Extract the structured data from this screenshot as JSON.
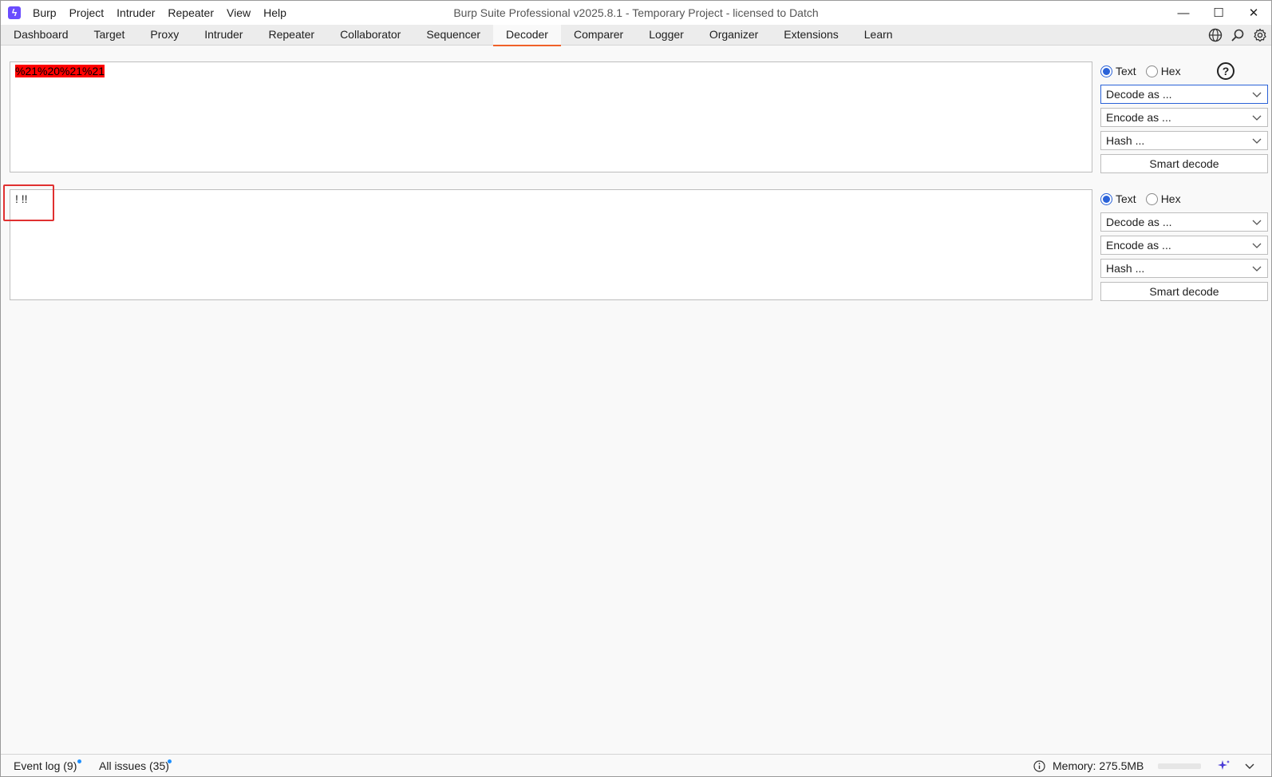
{
  "app": {
    "title": "Burp Suite Professional v2025.8.1 - Temporary Project - licensed to Datch",
    "logo_icon": "burp-logo-icon",
    "brand_color": "#6a4cff",
    "accent_color": "#f06129"
  },
  "menu": [
    "Burp",
    "Project",
    "Intruder",
    "Repeater",
    "View",
    "Help"
  ],
  "window_controls": {
    "minimize": "—",
    "maximize": "☐",
    "close": "✕"
  },
  "tabs": [
    {
      "label": "Dashboard"
    },
    {
      "label": "Target"
    },
    {
      "label": "Proxy"
    },
    {
      "label": "Intruder"
    },
    {
      "label": "Repeater"
    },
    {
      "label": "Collaborator"
    },
    {
      "label": "Sequencer"
    },
    {
      "label": "Decoder",
      "active": true
    },
    {
      "label": "Comparer"
    },
    {
      "label": "Logger"
    },
    {
      "label": "Organizer"
    },
    {
      "label": "Extensions"
    },
    {
      "label": "Learn"
    }
  ],
  "tab_icons": [
    "globe-icon",
    "search-icon",
    "gear-icon"
  ],
  "decoder": {
    "editor1": {
      "text": "%21%20%21%21"
    },
    "editor2": {
      "text": "! !!"
    },
    "panel": {
      "text_label": "Text",
      "hex_label": "Hex",
      "decode_label": "Decode as ...",
      "encode_label": "Encode as ...",
      "hash_label": "Hash ...",
      "smart_decode_label": "Smart decode",
      "help_label": "?"
    }
  },
  "status": {
    "event_log": "Event log (9)",
    "all_issues": "All issues (35)",
    "memory": "Memory: 275.5MB"
  }
}
